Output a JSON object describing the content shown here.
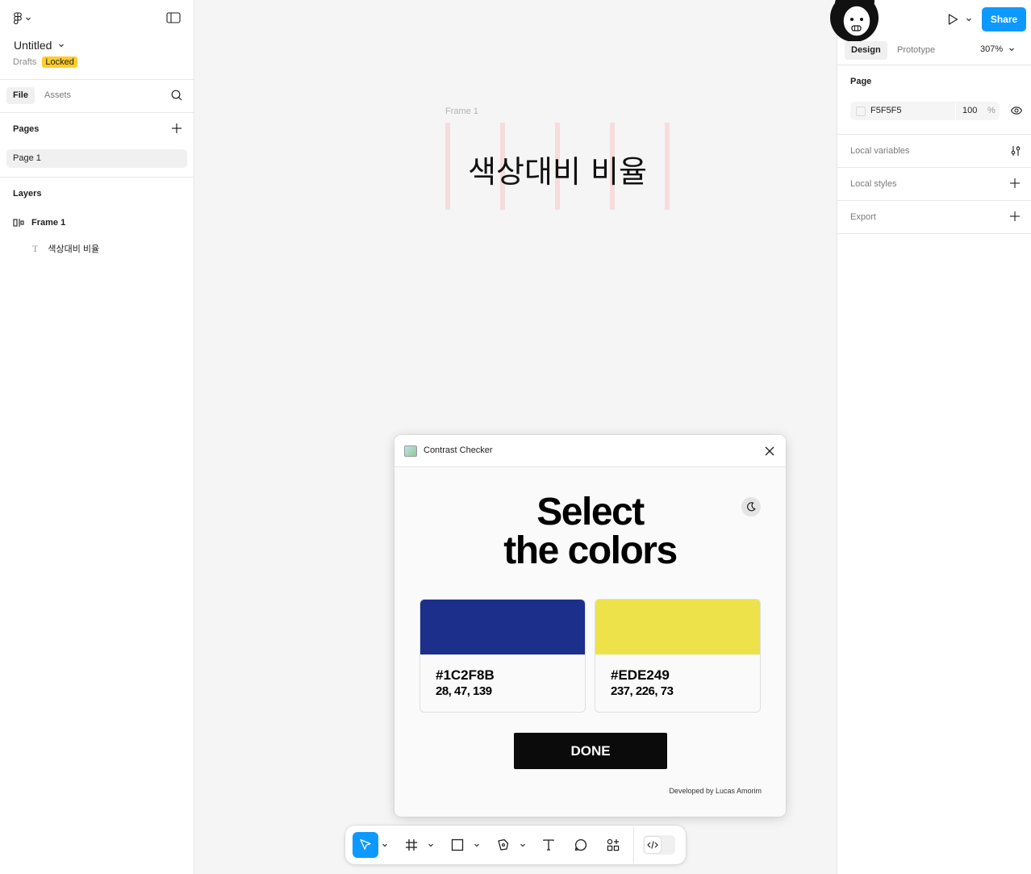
{
  "left_panel": {
    "file_title": "Untitled",
    "drafts_label": "Drafts",
    "locked_badge": "Locked",
    "tabs": {
      "file": "File",
      "assets": "Assets"
    },
    "pages_label": "Pages",
    "pages": [
      {
        "label": "Page 1"
      }
    ],
    "layers_label": "Layers",
    "layers": [
      {
        "label": "Frame 1",
        "icon": "frame-layout-icon"
      },
      {
        "label": "색상대비 비율",
        "icon": "text-icon"
      }
    ]
  },
  "canvas": {
    "frame_label": "Frame 1",
    "frame_text": "색상대비 비율",
    "background": "#F5F5F5"
  },
  "plugin": {
    "title": "Contrast Checker",
    "heading_line1": "Select",
    "heading_line2": "the colors",
    "colors": [
      {
        "hex": "#1C2F8B",
        "rgb": "28, 47, 139",
        "swatch": "#1C2F8B"
      },
      {
        "hex": "#EDE249",
        "rgb": "237, 226, 73",
        "swatch": "#EDE249"
      }
    ],
    "done_label": "DONE",
    "credit": "Developed by Lucas Amorim"
  },
  "toolbar": {
    "tools": [
      "move-tool",
      "frame-tool",
      "shape-tool",
      "pen-tool",
      "text-tool",
      "comment-tool",
      "actions-tool"
    ],
    "dev_mode": "dev-mode-toggle"
  },
  "right_panel": {
    "share_label": "Share",
    "tabs": {
      "design": "Design",
      "prototype": "Prototype"
    },
    "zoom": "307%",
    "page_section": {
      "label": "Page",
      "bg_hex": "F5F5F5",
      "opacity": "100",
      "opacity_unit": "%"
    },
    "rows": [
      {
        "label": "Local variables"
      },
      {
        "label": "Local styles"
      },
      {
        "label": "Export"
      }
    ]
  },
  "help_label": "?",
  "accent_color": "#0D99FF",
  "locked_color": "#FFCD29"
}
